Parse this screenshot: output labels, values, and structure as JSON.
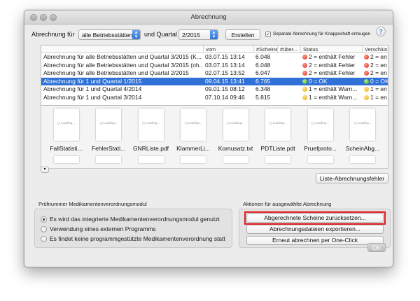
{
  "window": {
    "title": "Abrechnung"
  },
  "toolbar": {
    "label_for": "Abrechnung für",
    "scope_value": "alle Betriebsstätten",
    "label_quarter": "und Quartal",
    "quarter_value": "2/2015",
    "create_button": "Erstellen",
    "separate_checkbox": "Separate Abrechnung für  Knappschaft erzeugen",
    "help": "?"
  },
  "table": {
    "columns": [
      "",
      "vom",
      "#Scheine",
      "#über...",
      "Status",
      "Verschlüs"
    ],
    "rows": [
      {
        "name": "Abrechnung für alle Betriebsstätten und Quartal 3/2015 (K...",
        "vom": "03.07.15 13:14",
        "scheine": "6.048",
        "status": "2 = enthält Fehler",
        "status2": "2 = en",
        "color": "red",
        "selected": false
      },
      {
        "name": "Abrechnung für alle Betriebsstätten und Quartal 3/2015 (oh...",
        "vom": "03.07.15 13:14",
        "scheine": "6.048",
        "status": "2 = enthält Fehler",
        "status2": "2 = en",
        "color": "red",
        "selected": false
      },
      {
        "name": "Abrechnung für alle Betriebsstätten und Quartal 2/2015",
        "vom": "02.07.15 13:52",
        "scheine": "6.047",
        "status": "2 = enthält Fehler",
        "status2": "2 = en",
        "color": "red",
        "selected": false
      },
      {
        "name": "Abrechnung für 1 und Quartal 1/2015",
        "vom": "09.04.15 13:41",
        "scheine": "6.765",
        "status": "0 = OK",
        "status2": "0 = OK",
        "color": "green",
        "selected": true
      },
      {
        "name": "Abrechnung für 1 und Quartal 4/2014",
        "vom": "09.01.15 08:12",
        "scheine": "6.348",
        "status": "1 = enthält Warn...",
        "status2": "1 = en",
        "color": "yellow",
        "selected": false
      },
      {
        "name": "Abrechnung für 1 und Quartal 3/2014",
        "vom": "07.10.14 09:46",
        "scheine": "5.815",
        "status": "1 = enthält Warn...",
        "status2": "1 = en",
        "color": "yellow",
        "selected": false
      }
    ]
  },
  "thumbnails": {
    "loading_text": "Loading...",
    "items": [
      "FallStatisti...",
      "FehlerStati...",
      "GNRListe.pdf",
      "KlammerLi...",
      "Kornusatz.txt",
      "PDTListe.pdt",
      "Pruefproto...",
      "ScheinAbg..."
    ]
  },
  "list_errors_button": "Liste-Abrechnungsfehler",
  "collapse_button": "▾",
  "pruefnummer": {
    "label": "Prüfnummer Medikamentenverordnungsmodul",
    "options": [
      {
        "label": "Es wird das integrierte Medikamentenverordnungsmodul genutzt",
        "selected": true
      },
      {
        "label": "Verwendung eines externen Programms",
        "selected": false
      },
      {
        "label": "Es findet keine programmgestützte Medikamentenverordnung statt",
        "selected": false
      }
    ]
  },
  "actions": {
    "label": "Aktionen für ausgewählte Abrechnung",
    "reset_button": "Abgerechnete Scheine zurücksetzen...",
    "export_button": "Abrechnungsdateien exportieren...",
    "oneclick_button": "Erneut abrechnen per One-Click"
  },
  "ok_button": "OK",
  "colors": {
    "selection": "#2f71d6",
    "highlight": "#e11b22"
  }
}
